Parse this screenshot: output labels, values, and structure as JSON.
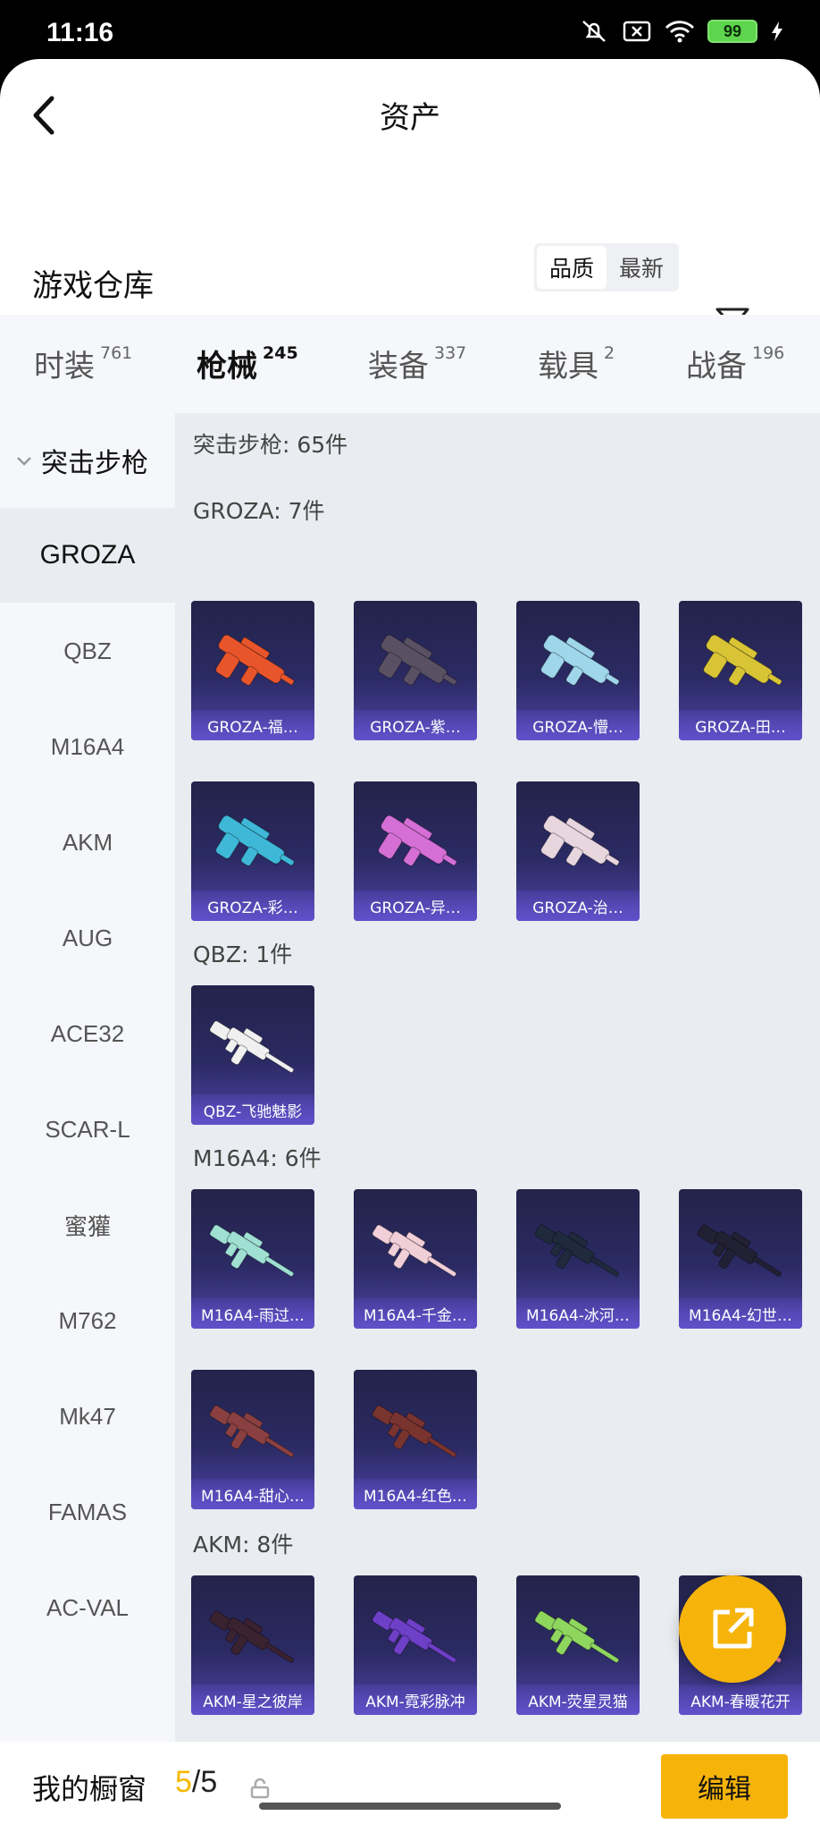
{
  "status_bar": {
    "time": "11:16",
    "battery": "99"
  },
  "header": {
    "title": "资产"
  },
  "warehouse": {
    "title": "游戏仓库",
    "sort_options": [
      "品质",
      "最新"
    ],
    "active_sort": "品质"
  },
  "tabs": [
    {
      "label": "时装",
      "count": "761"
    },
    {
      "label": "枪械",
      "count": "245"
    },
    {
      "label": "装备",
      "count": "337"
    },
    {
      "label": "载具",
      "count": "2"
    },
    {
      "label": "战备",
      "count": "196"
    }
  ],
  "sidebar": {
    "category": "突击步枪",
    "items": [
      "GROZA",
      "QBZ",
      "M16A4",
      "AKM",
      "AUG",
      "ACE32",
      "SCAR-L",
      "蜜獾",
      "M762",
      "Mk47",
      "FAMAS",
      "AC-VAL"
    ]
  },
  "content": {
    "summary": "突击步枪: 65件",
    "sections": [
      {
        "label": "GROZA: 7件",
        "items": [
          "GROZA-福…",
          "GROZA-紫…",
          "GROZA-懵…",
          "GROZA-田…",
          "GROZA-彩…",
          "GROZA-异…",
          "GROZA-治…"
        ]
      },
      {
        "label": "QBZ: 1件",
        "items": [
          "QBZ-飞驰魅影"
        ]
      },
      {
        "label": "M16A4: 6件",
        "items": [
          "M16A4-雨过…",
          "M16A4-千金…",
          "M16A4-冰河…",
          "M16A4-幻世…",
          "M16A4-甜心…",
          "M16A4-红色…"
        ]
      },
      {
        "label": "AKM: 8件",
        "items": [
          "AKM-星之彼岸",
          "AKM-霓彩脉冲",
          "AKM-荧星灵猫",
          "AKM-春暖花开"
        ]
      }
    ]
  },
  "gun_colors": {
    "GROZA": [
      "#e9552b",
      "#5a5064",
      "#9fd6ea",
      "#d9c436",
      "#3fb8d8",
      "#d56fd6",
      "#e8d6df"
    ],
    "QBZ": [
      "#f0f0f0"
    ],
    "M16A4": [
      "#9fe0d3",
      "#f1cfd8",
      "#1f2a3d",
      "#222033",
      "#8a4040",
      "#7a3430"
    ],
    "AKM": [
      "#3a2231",
      "#6e3fc7",
      "#8fd65e",
      "#e27aa7"
    ]
  },
  "bottom_bar": {
    "label": "我的橱窗",
    "count_current": "5",
    "count_total": "/5",
    "edit_label": "编辑"
  },
  "colors": {
    "accent": "#f5b800",
    "card_bg": "#2b2a63",
    "card_caption": "#6150c9"
  }
}
